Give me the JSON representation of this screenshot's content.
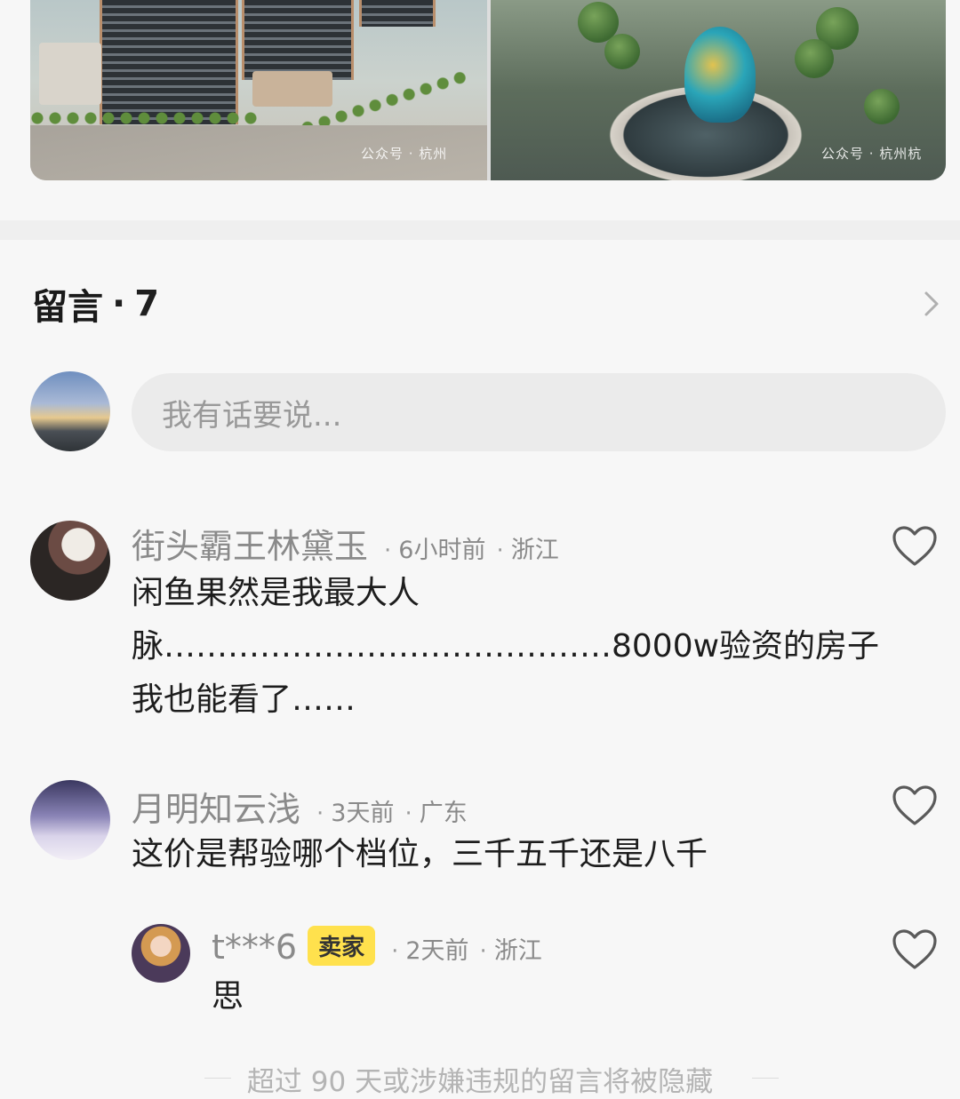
{
  "gallery": {
    "watermark_left": "公众号 · 杭州",
    "watermark_right": "公众号 · 杭州杭"
  },
  "comments_section": {
    "title": "留言",
    "separator": "·",
    "count": "7",
    "input_placeholder": "我有话要说..."
  },
  "comments": [
    {
      "name": "街头霸王林黛玉",
      "time": "6小时前",
      "region": "浙江",
      "lines": [
        "闲鱼果然是我最大人",
        "脉……………………………………8000w验资的房子",
        "我也能看了……"
      ]
    },
    {
      "name": "月明知云浅",
      "time": "3天前",
      "region": "广东",
      "lines": [
        "这价是帮验哪个档位，三千五千还是八千"
      ]
    }
  ],
  "reply": {
    "name": "t***6",
    "badge": "卖家",
    "time": "2天前",
    "region": "浙江",
    "text": "思"
  },
  "footer": {
    "note": "超过 90 天或涉嫌违规的留言将被隐藏"
  },
  "colors": {
    "accent_badge": "#ffe14d",
    "muted_text": "#8a8a8a",
    "input_bg": "#ebebeb"
  }
}
